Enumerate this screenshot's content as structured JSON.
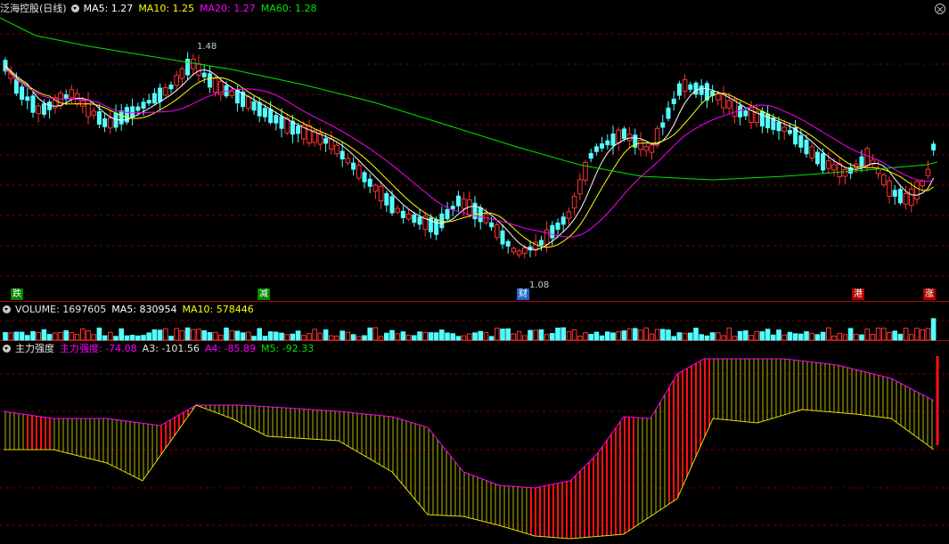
{
  "header": {
    "stock_title": "泛海控股(日线)",
    "ma5": "MA5: 1.27",
    "ma10": "MA10: 1.25",
    "ma20": "MA20: 1.27",
    "ma60": "MA60: 1.28"
  },
  "price_annotations": {
    "high": "1.48",
    "low": "1.08"
  },
  "events": {
    "die": "跌",
    "jian": "减",
    "cai": "财",
    "gang": "港",
    "zhang": "涨"
  },
  "volume_header": {
    "label": "VOLUME: 1697605",
    "ma5": "MA5: 830954",
    "ma10": "MA10: 578446"
  },
  "indicator_header": {
    "name": "主力强度",
    "main": "主力强度: -74.08",
    "a3": "A3: -101.56",
    "a4": "A4: -85.89",
    "m5": "M5: -92.33"
  },
  "colors": {
    "up": "#ff3232",
    "down": "#54ffff",
    "ma5": "#ffffff",
    "ma10": "#ffff00",
    "ma20": "#ff00ff",
    "ma60": "#00e600",
    "grid": "#7a0000",
    "axis": "#b00000"
  },
  "chart_data": {
    "type": "candlestick",
    "price_high": 1.48,
    "price_low": 1.08,
    "ma": {
      "MA5": 1.27,
      "MA10": 1.25,
      "MA20": 1.27,
      "MA60": 1.28
    },
    "volume": {
      "VOLUME": 1697605,
      "MA5": 830954,
      "MA10": 578446
    },
    "indicator": {
      "主力强度": -74.08,
      "A3": -101.56,
      "A4": -85.89,
      "M5": -92.33
    }
  }
}
